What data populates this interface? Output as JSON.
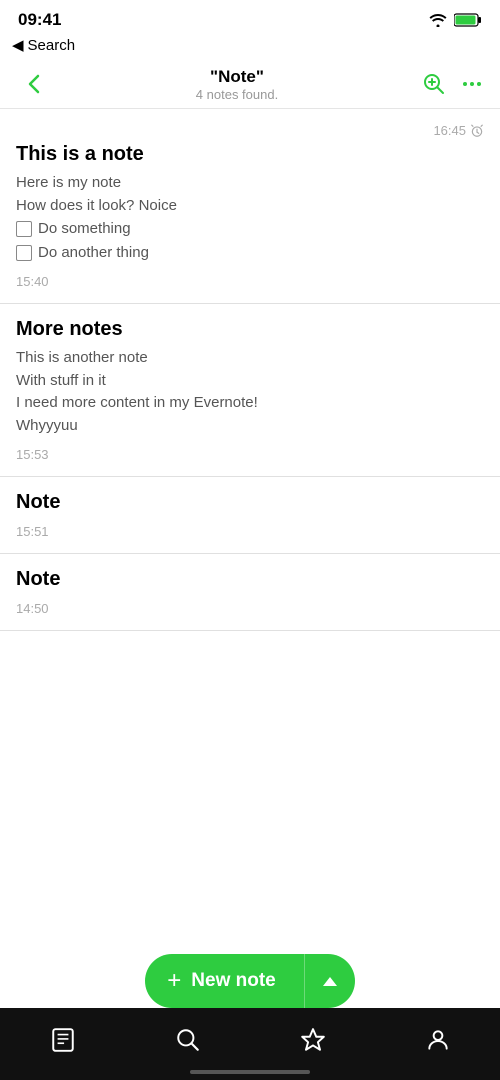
{
  "status": {
    "time": "09:41",
    "back_label": "Search"
  },
  "header": {
    "title": "\"Note\"",
    "subtitle": "4 notes found.",
    "back_icon": "chevron-left",
    "search_icon": "search-plus",
    "more_icon": "ellipsis"
  },
  "notes": [
    {
      "id": "note1",
      "title": "This is a note",
      "timestamp_top": "16:45",
      "has_alarm": true,
      "body_lines": [
        "Here is my note",
        "How does it look? Noice"
      ],
      "checkboxes": [
        {
          "label": "Do something",
          "checked": false
        },
        {
          "label": "Do another thing",
          "checked": false
        }
      ],
      "timestamp_bottom": "15:40"
    },
    {
      "id": "note2",
      "title": "More notes",
      "timestamp_top": null,
      "has_alarm": false,
      "body_lines": [
        "This is another note",
        "With stuff in it",
        "I need more content in my Evernote!",
        "Whyyyuu"
      ],
      "checkboxes": [],
      "timestamp_bottom": "15:53"
    },
    {
      "id": "note3",
      "title": "Note",
      "timestamp_top": null,
      "has_alarm": false,
      "body_lines": [],
      "checkboxes": [],
      "timestamp_bottom": "15:51"
    },
    {
      "id": "note4",
      "title": "Note",
      "timestamp_top": null,
      "has_alarm": false,
      "body_lines": [],
      "checkboxes": [],
      "timestamp_bottom": "14:50"
    }
  ],
  "new_note_button": {
    "plus": "+",
    "label": "New note",
    "chevron": "^"
  },
  "bottom_nav": {
    "items": [
      {
        "icon": "notes-icon",
        "label": "Notes"
      },
      {
        "icon": "search-icon",
        "label": "Search"
      },
      {
        "icon": "star-icon",
        "label": "Favorites"
      },
      {
        "icon": "person-icon",
        "label": "Account"
      }
    ]
  }
}
